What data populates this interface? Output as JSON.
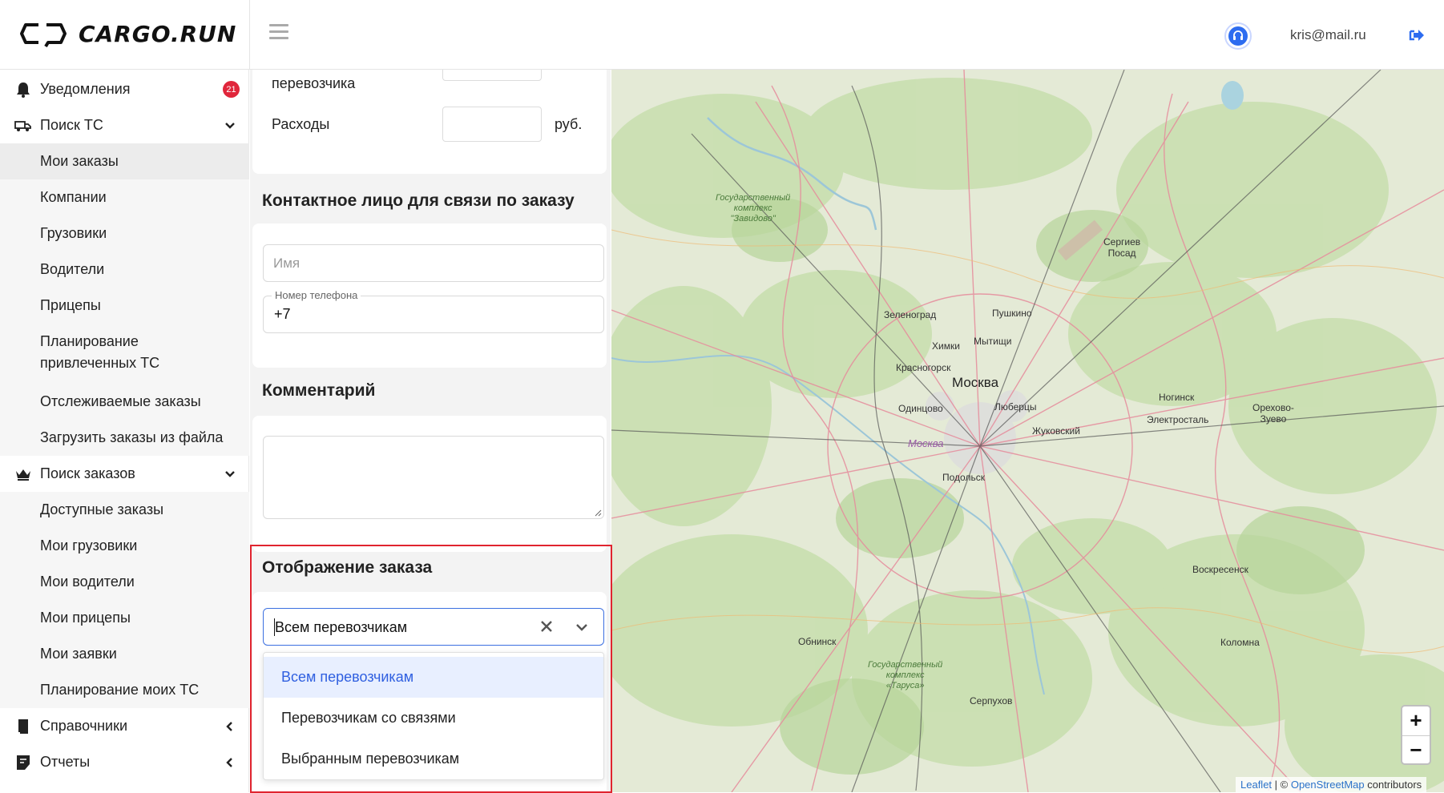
{
  "header": {
    "logo_text": "CARGO.RUN",
    "user_email": "kris@mail.ru"
  },
  "sidebar": {
    "notifications": {
      "label": "Уведомления",
      "badge": "21"
    },
    "search_vehicles": {
      "label": "Поиск ТС",
      "items": [
        "Мои заказы",
        "Компании",
        "Грузовики",
        "Водители",
        "Прицепы",
        "Планирование привлеченных ТС",
        "Отслеживаемые заказы",
        "Загрузить заказы из файла"
      ],
      "active_item": "Мои заказы"
    },
    "search_orders": {
      "label": "Поиск заказов",
      "items": [
        "Доступные заказы",
        "Мои грузовики",
        "Мои водители",
        "Мои прицепы",
        "Мои заявки",
        "Планирование моих ТС"
      ]
    },
    "references": {
      "label": "Справочники"
    },
    "reports": {
      "label": "Отчеты"
    }
  },
  "form": {
    "carrier_label": "перевозчика",
    "expenses_label": "Расходы",
    "currency": "руб.",
    "contact_section": {
      "title": "Контактное лицо для связи по заказу",
      "name_placeholder": "Имя",
      "phone_label": "Номер телефона",
      "phone_value": "+7"
    },
    "comment_section": {
      "title": "Комментарий"
    },
    "display_section": {
      "title": "Отображение заказа",
      "selected_value": "Всем перевозчикам",
      "options": [
        "Всем перевозчикам",
        "Перевозчикам со связями",
        "Выбранным перевозчикам"
      ]
    }
  },
  "map": {
    "labels": {
      "moscow": "Москва",
      "moscow_region": "Москва",
      "zelenograd": "Зеленоград",
      "pushkino": "Пушкино",
      "khimki": "Химки",
      "mytishchi": "Мытищи",
      "krasnogorsk": "Красногорск",
      "odintsovo": "Одинцово",
      "lyubertsy": "Люберцы",
      "zhukovsky": "Жуковский",
      "podolsk": "Подольск",
      "noginsk": "Ногинск",
      "elektrostal": "Электросталь",
      "orekhovo": "Орехово-\nЗуево",
      "sergiev": "Сергиев\nПосад",
      "voskresensk": "Воскресенск",
      "kolomna": "Коломна",
      "obninsk": "Обнинск",
      "serpukhov": "Серпухов",
      "zavidovo": "Государственный\nкомплекс\n\"Завидово\"",
      "tarusa": "Государственный\nкомплекс\n«Таруса»"
    },
    "zoom_in": "+",
    "zoom_out": "−",
    "attribution": {
      "leaflet": "Leaflet",
      "separator": " | © ",
      "osm": "OpenStreetMap",
      "contributors": " contributors"
    }
  }
}
